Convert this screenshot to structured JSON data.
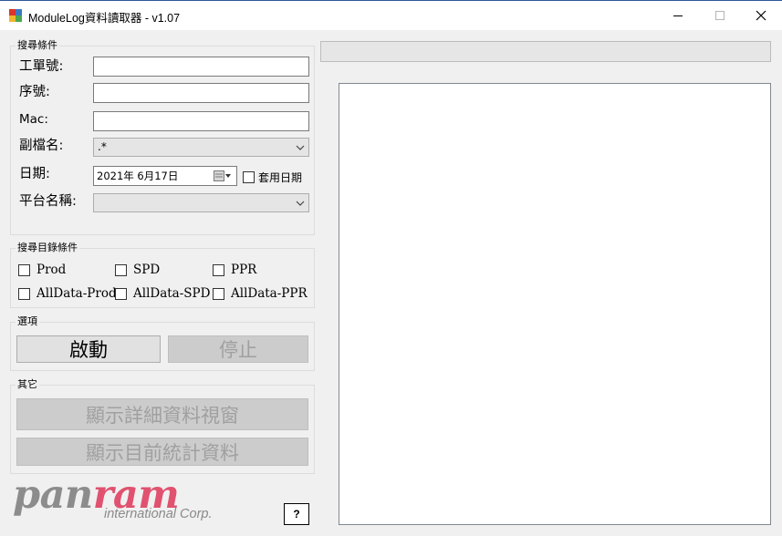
{
  "window": {
    "title": "ModuleLog資料讀取器 - v1.07",
    "icon": "app-window-icon",
    "controls": [
      "minimize-icon",
      "maximize-icon",
      "close-icon"
    ]
  },
  "search_conditions": {
    "group_label": "搜尋條件",
    "work_order_label": "工單號:",
    "work_order_value": "",
    "serial_label": "序號:",
    "serial_value": "",
    "mac_label": "Mac:",
    "mac_value": "",
    "extension_label": "副檔名:",
    "extension_value": ".*",
    "date_label": "日期:",
    "date_value": "2021年  6月17日",
    "apply_date_label": "套用日期",
    "apply_date_checked": false,
    "platform_label": "平台名稱:",
    "platform_value": ""
  },
  "directory_conditions": {
    "group_label": "搜尋目錄條件",
    "options": [
      {
        "label": "Prod",
        "checked": false
      },
      {
        "label": "SPD",
        "checked": false
      },
      {
        "label": "PPR",
        "checked": false
      },
      {
        "label": "AllData-Prod",
        "checked": false
      },
      {
        "label": "AllData-SPD",
        "checked": false
      },
      {
        "label": "AllData-PPR",
        "checked": false
      }
    ]
  },
  "options_group": {
    "group_label": "選項",
    "start_label": "啟動",
    "stop_label": "停止"
  },
  "other_group": {
    "group_label": "其它",
    "detail_window_label": "顯示詳細資料視窗",
    "stats_label": "顯示目前統計資料"
  },
  "logo": {
    "pan": "pan",
    "ram": "ram",
    "subtitle": "international Corp.",
    "pan_color": "#8c8c8c",
    "ram_color": "#e0526f"
  },
  "help_label": "?",
  "progress": {
    "value": 0
  },
  "log_text": ""
}
